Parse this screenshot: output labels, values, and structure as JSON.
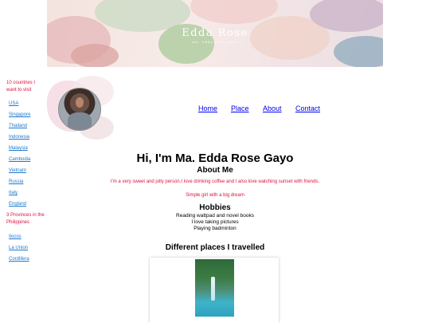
{
  "banner": {
    "title": "Edda Rose",
    "subtitle": "ma. edda rose gayo"
  },
  "nav": {
    "items": [
      "Home",
      "Place",
      "About",
      "Contact"
    ]
  },
  "sidebar": {
    "countries_heading": "10 countries I want to visit",
    "countries": [
      "USA",
      "Singapore",
      "Thailand",
      "Indonesia",
      "Malaysia",
      "Cambodia",
      "Vietnam",
      "Russia",
      "Italy",
      "England"
    ],
    "provinces_heading": "3 Provinces in the Philippines",
    "provinces": [
      "Ilocos",
      "La Union",
      "Cordillera"
    ]
  },
  "main": {
    "hero": "Hi, I'm Ma. Edda Rose Gayo",
    "about_heading": "About Me",
    "about_text": "I'm a very sweet and jolly person.I love drinking coffee and I also love watching sunset with friends.",
    "tagline": "Simple girl with a big dream",
    "hobbies_heading": "Hobbies",
    "hobbies": [
      "Reading wattpad and novel books",
      "I love taking pictures",
      "Playing badminton"
    ],
    "places_heading": "Different places I travelled"
  },
  "colors": {
    "accent_red": "#e0103e",
    "link_blue": "#1e77cc",
    "nav_blue": "#0000ee"
  }
}
